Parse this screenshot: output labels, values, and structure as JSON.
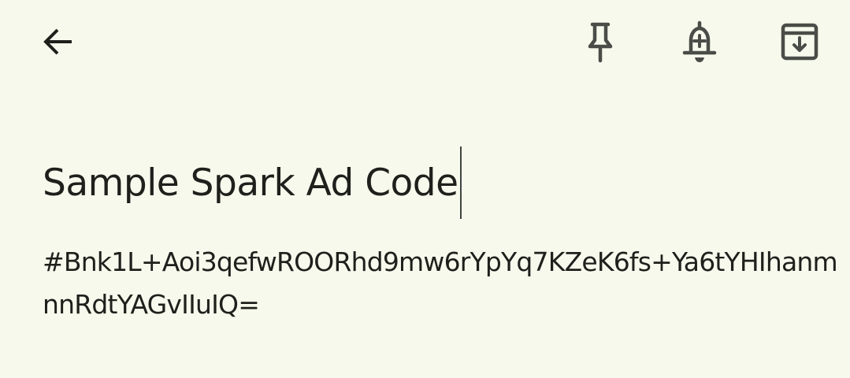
{
  "toolbar": {
    "icons": {
      "back": "arrow-left-icon",
      "pin": "pin-icon",
      "reminder": "bell-plus-icon",
      "archive": "archive-icon"
    },
    "icon_color": "#4a4c48"
  },
  "note": {
    "title": "Sample Spark Ad Code",
    "body": "#Bnk1L+Aoi3qefwROORhd9mw6rYpYq7KZeK6fs+Ya6tYHIhanmnnRdtYAGvIIuIQ="
  },
  "colors": {
    "background": "#f7f9ec",
    "text": "#1f1f1c"
  }
}
